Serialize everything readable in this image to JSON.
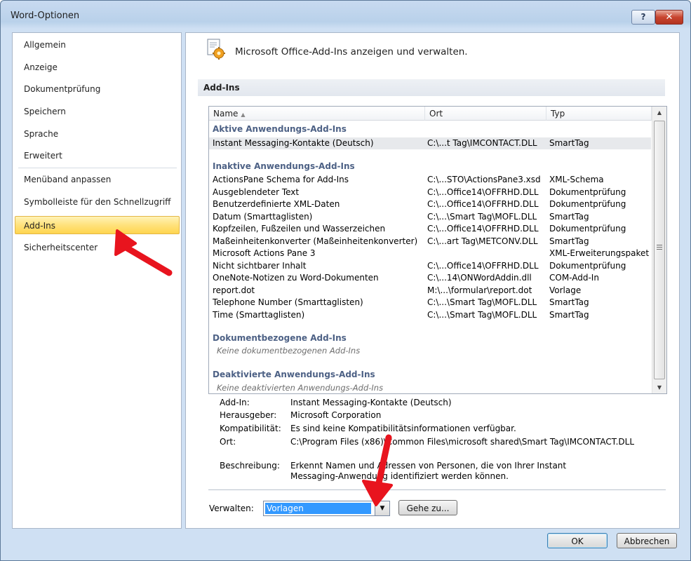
{
  "window": {
    "title": "Word-Optionen",
    "help_glyph": "?",
    "close_glyph": "✕"
  },
  "nav": {
    "items": [
      {
        "label": "Allgemein"
      },
      {
        "label": "Anzeige"
      },
      {
        "label": "Dokumentprüfung"
      },
      {
        "label": "Speichern"
      },
      {
        "label": "Sprache"
      },
      {
        "label": "Erweitert"
      },
      {
        "label": "Menüband anpassen"
      },
      {
        "label": "Symbolleiste für den Schnellzugriff"
      },
      {
        "label": "Add-Ins",
        "selected": true
      },
      {
        "label": "Sicherheitscenter"
      }
    ]
  },
  "header": {
    "text": "Microsoft Office-Add-Ins anzeigen und verwalten.",
    "icon": "addin-gear-icon"
  },
  "section": {
    "title": "Add-Ins"
  },
  "table": {
    "columns": [
      "Name",
      "Ort",
      "Typ"
    ],
    "sort_glyph": "▲",
    "groups": [
      {
        "title": "Aktive Anwendungs-Add-Ins",
        "rows": [
          {
            "name": "Instant Messaging-Kontakte (Deutsch)",
            "ort": "C:\\...t Tag\\IMCONTACT.DLL",
            "typ": "SmartTag",
            "selected": true
          }
        ]
      },
      {
        "title": "Inaktive Anwendungs-Add-Ins",
        "rows": [
          {
            "name": "ActionsPane Schema for Add-Ins",
            "ort": "C:\\...STO\\ActionsPane3.xsd",
            "typ": "XML-Schema"
          },
          {
            "name": "Ausgeblendeter Text",
            "ort": "C:\\...Office14\\OFFRHD.DLL",
            "typ": "Dokumentprüfung"
          },
          {
            "name": "Benutzerdefinierte XML-Daten",
            "ort": "C:\\...Office14\\OFFRHD.DLL",
            "typ": "Dokumentprüfung"
          },
          {
            "name": "Datum (Smarttaglisten)",
            "ort": "C:\\...\\Smart Tag\\MOFL.DLL",
            "typ": "SmartTag"
          },
          {
            "name": "Kopfzeilen, Fußzeilen und Wasserzeichen",
            "ort": "C:\\...Office14\\OFFRHD.DLL",
            "typ": "Dokumentprüfung"
          },
          {
            "name": "Maßeinheitenkonverter (Maßeinheitenkonverter)",
            "ort": "C:\\...art Tag\\METCONV.DLL",
            "typ": "SmartTag"
          },
          {
            "name": "Microsoft Actions Pane 3",
            "ort": "",
            "typ": "XML-Erweiterungspaket"
          },
          {
            "name": "Nicht sichtbarer Inhalt",
            "ort": "C:\\...Office14\\OFFRHD.DLL",
            "typ": "Dokumentprüfung"
          },
          {
            "name": "OneNote-Notizen zu Word-Dokumenten",
            "ort": "C:\\...14\\ONWordAddin.dll",
            "typ": "COM-Add-In"
          },
          {
            "name": "report.dot",
            "ort": "M:\\...\\formular\\report.dot",
            "typ": "Vorlage"
          },
          {
            "name": "Telephone Number (Smarttaglisten)",
            "ort": "C:\\...\\Smart Tag\\MOFL.DLL",
            "typ": "SmartTag"
          },
          {
            "name": "Time (Smarttaglisten)",
            "ort": "C:\\...\\Smart Tag\\MOFL.DLL",
            "typ": "SmartTag"
          }
        ]
      },
      {
        "title": "Dokumentbezogene Add-Ins",
        "empty_text": "Keine dokumentbezogenen Add-Ins",
        "rows": []
      },
      {
        "title": "Deaktivierte Anwendungs-Add-Ins",
        "empty_text": "Keine deaktivierten Anwendungs-Add-Ins",
        "rows": []
      }
    ]
  },
  "details": {
    "addin_label": "Add-In:",
    "addin_value": "Instant Messaging-Kontakte (Deutsch)",
    "publisher_label": "Herausgeber:",
    "publisher_value": "Microsoft Corporation",
    "compat_label": "Kompatibilität:",
    "compat_value": "Es sind keine Kompatibilitätsinformationen verfügbar.",
    "location_label": "Ort:",
    "location_value": "C:\\Program Files (x86)\\Common Files\\microsoft shared\\Smart Tag\\IMCONTACT.DLL",
    "desc_label": "Beschreibung:",
    "desc_line1": "Erkennt Namen und Adressen von Personen, die von Ihrer Instant",
    "desc_line2": "Messaging-Anwendung identifiziert werden können."
  },
  "manage": {
    "label": "Verwalten:",
    "selected": "Vorlagen",
    "dropdown_glyph": "▼",
    "go_button": "Gehe zu..."
  },
  "footer": {
    "ok": "OK",
    "cancel": "Abbrechen"
  },
  "colors": {
    "annotation_arrow": "#e8141e",
    "selection": "#3399ff",
    "nav_active": "#ffd54f"
  }
}
